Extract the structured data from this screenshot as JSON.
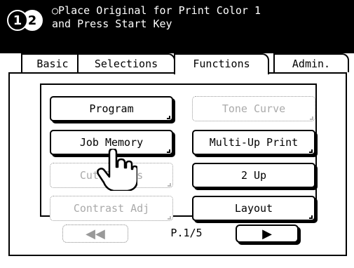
{
  "header": {
    "badge_1": "1",
    "badge_2": "2",
    "message_line_1": "○Place Original for Print Color 1",
    "message_line_2": "and Press Start Key"
  },
  "tabs": [
    {
      "label": "Basic"
    },
    {
      "label": "Selections"
    },
    {
      "label": "Functions",
      "active": true
    },
    {
      "label": "Admin."
    }
  ],
  "buttons": {
    "program": "Program",
    "tone_curve": "Tone Curve",
    "job_memory": "Job Memory",
    "multi_up_print": "Multi-Up Print",
    "cut_bypass": "Cut Bypass",
    "two_up": "2 Up",
    "contrast_adj": "Contrast Adj",
    "layout": "Layout"
  },
  "pagination": {
    "prev_label": "◀◀",
    "page_indicator": "P.1/5",
    "next_label": "▶"
  },
  "icons": {
    "pointer": "hand-pointer-icon"
  }
}
